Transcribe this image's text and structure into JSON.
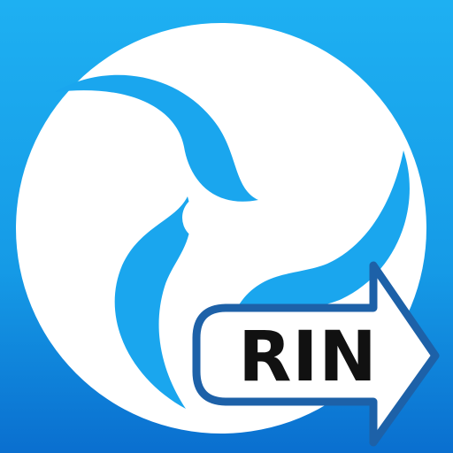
{
  "app_icon": {
    "badge_text": "RIN",
    "icons": {
      "swirl": "triple-swirl-logo-icon",
      "arrow": "arrow-right-icon"
    },
    "colors": {
      "background_top": "#1eb0f2",
      "background_bottom": "#0a6fcf",
      "swirl": "#ffffff",
      "arrow_fill": "#ffffff",
      "arrow_border": "#1d61a8",
      "text": "#111111"
    }
  }
}
